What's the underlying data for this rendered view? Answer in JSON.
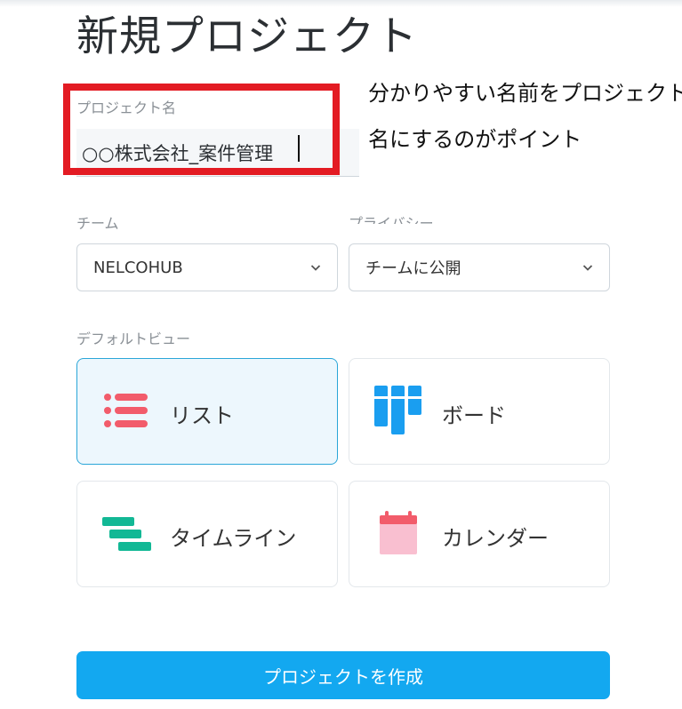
{
  "title": "新規プロジェクト",
  "project_name": {
    "label": "プロジェクト名",
    "value": "○○株式会社_案件管理"
  },
  "annotation": {
    "line1": "分かりやすい名前をプロジェクト",
    "line2": "名にするのがポイント",
    "color": "#e31b23"
  },
  "team": {
    "label": "チーム",
    "selected": "NELCOHUB"
  },
  "privacy": {
    "label": "プライバシー",
    "selected": "チームに公開"
  },
  "default_view": {
    "label": "デフォルトビュー",
    "options": [
      {
        "label": "リスト",
        "icon": "list-icon",
        "selected": true
      },
      {
        "label": "ボード",
        "icon": "board-icon",
        "selected": false
      },
      {
        "label": "タイムライン",
        "icon": "timeline-icon",
        "selected": false
      },
      {
        "label": "カレンダー",
        "icon": "calendar-icon",
        "selected": false
      }
    ]
  },
  "create_button": "プロジェクトを作成",
  "colors": {
    "accent": "#13a8f0",
    "list_icon": "#f25c6b",
    "board_icon": "#1a9ef0",
    "timeline_icon": "#12b895",
    "calendar_icon": "#f9bfd0"
  }
}
